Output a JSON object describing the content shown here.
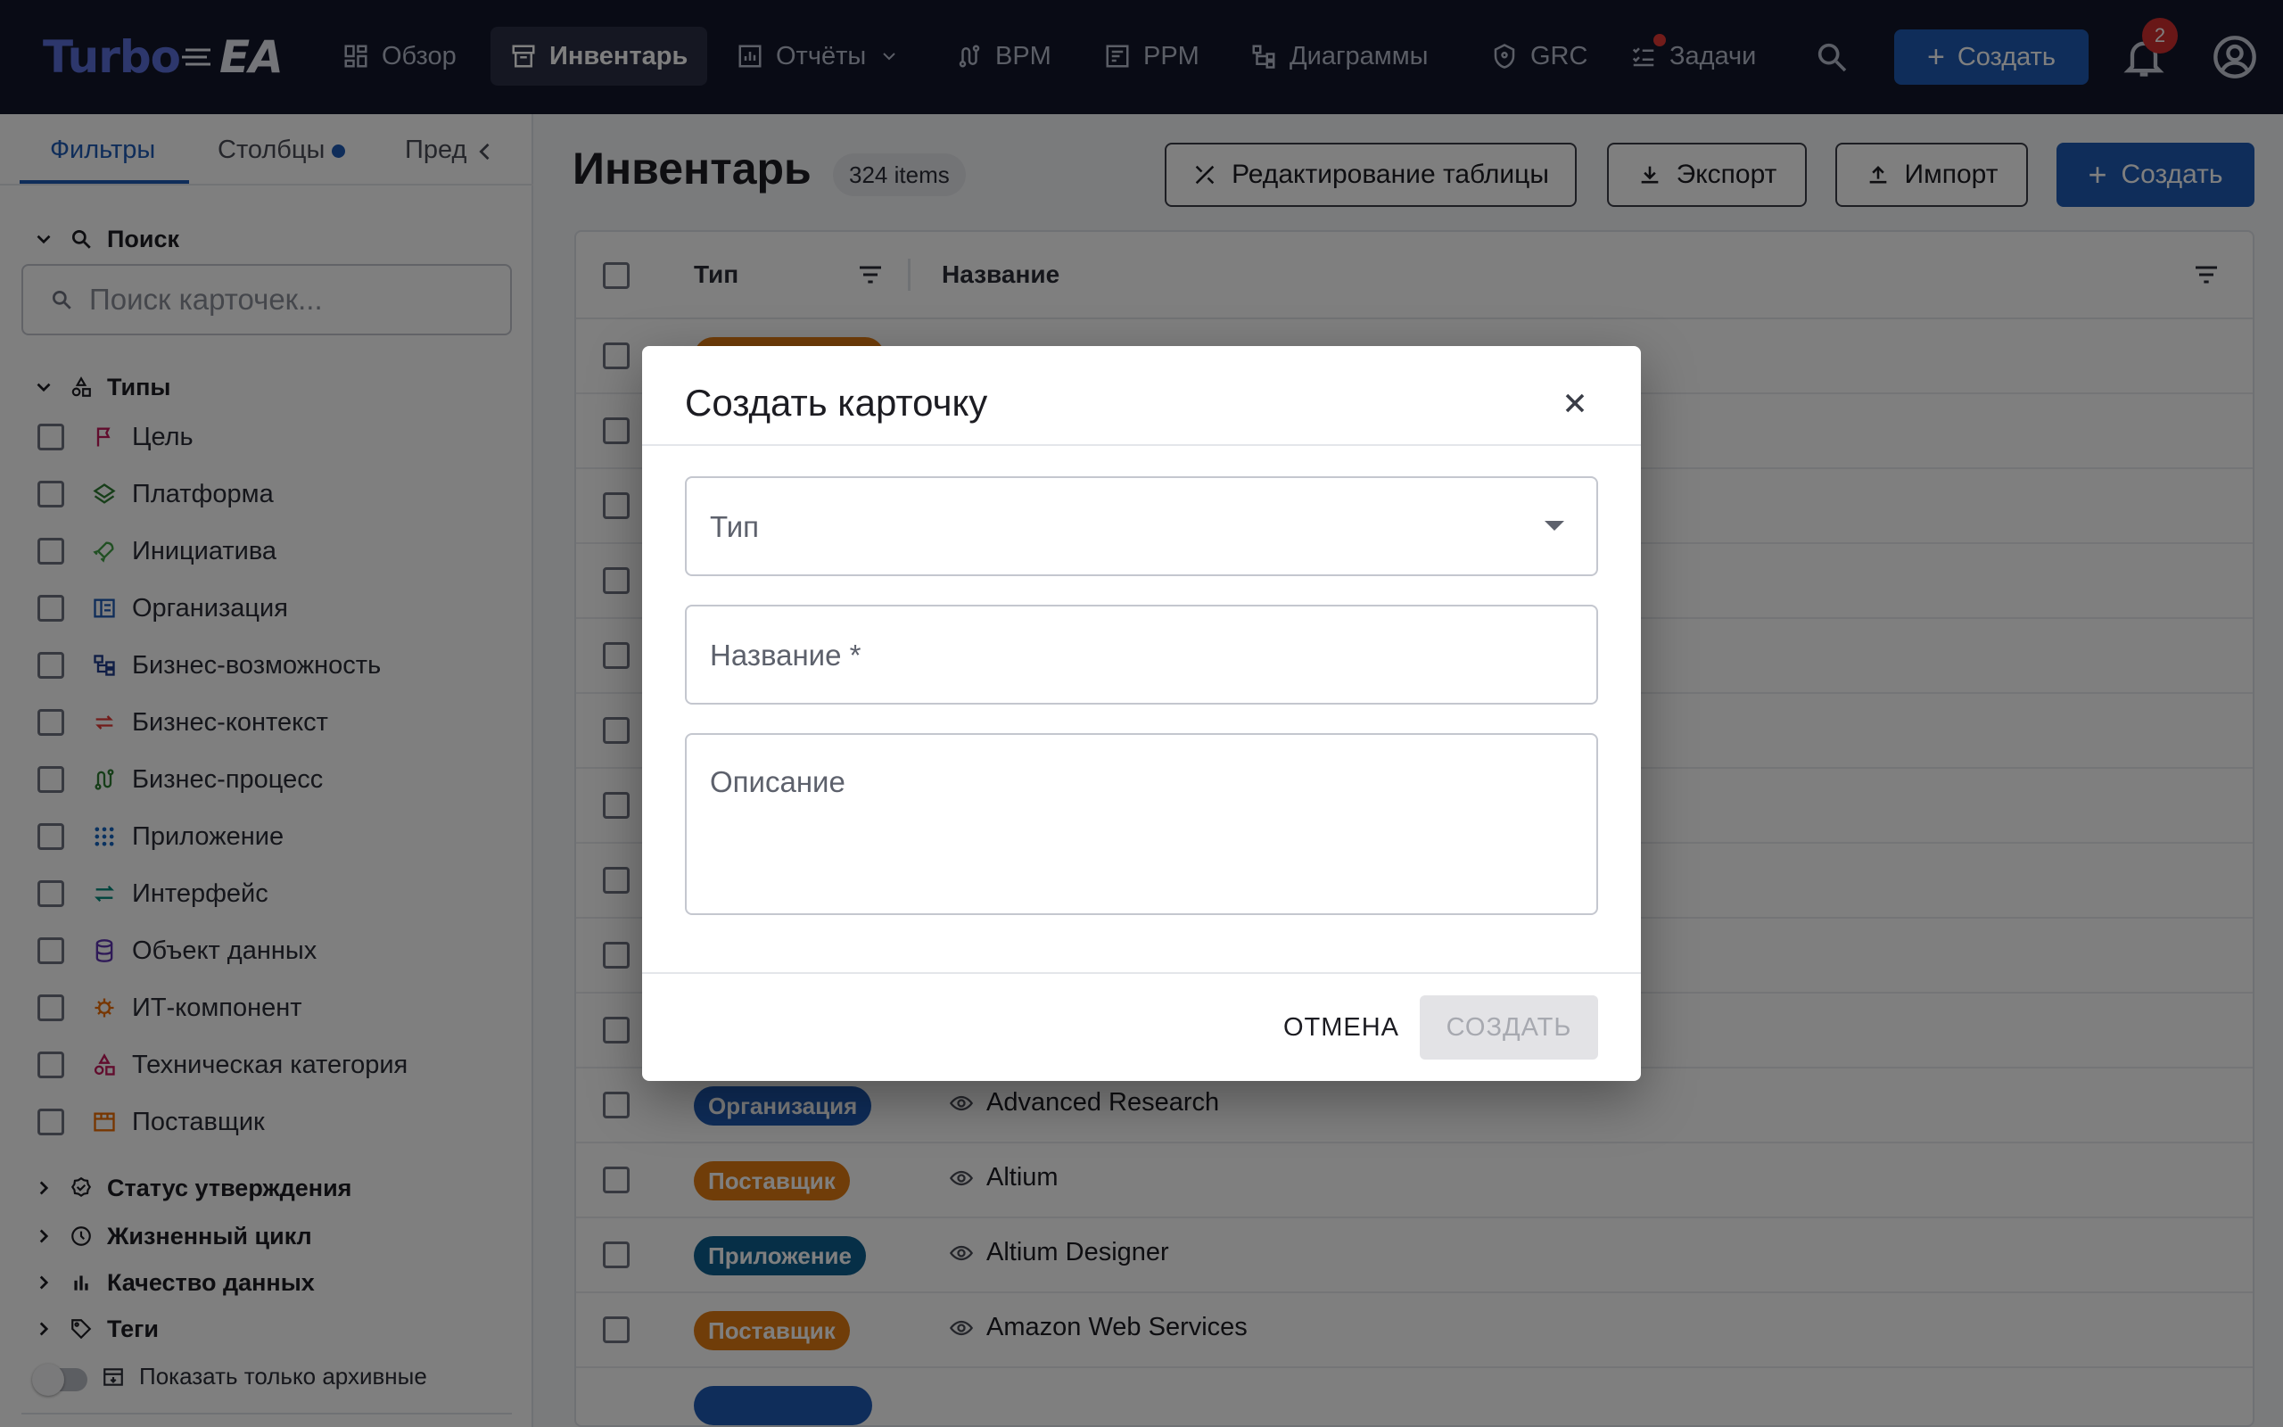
{
  "app": {
    "logo_part1": "Turbo",
    "logo_part2": "EA"
  },
  "nav": {
    "items": [
      {
        "label": "Обзор",
        "icon": "dashboard-icon"
      },
      {
        "label": "Инвентарь",
        "icon": "inventory-icon",
        "active": true
      },
      {
        "label": "Отчёты",
        "icon": "reports-icon",
        "has_dropdown": true
      },
      {
        "label": "BPM",
        "icon": "route-icon"
      },
      {
        "label": "PPM",
        "icon": "project-icon"
      },
      {
        "label": "Диаграммы",
        "icon": "diagram-icon"
      },
      {
        "label": "GRC",
        "icon": "shield-icon"
      },
      {
        "label": "Задачи",
        "icon": "tasks-icon",
        "dot": true
      }
    ],
    "create_label": "Создать",
    "notifications_count": "2"
  },
  "sidebar": {
    "tabs": [
      {
        "label": "Фильтры",
        "active": true
      },
      {
        "label": "Столбцы",
        "dot": true
      },
      {
        "label": "Пред"
      }
    ],
    "search": {
      "heading": "Поиск",
      "placeholder": "Поиск карточек..."
    },
    "types": {
      "heading": "Типы",
      "items": [
        {
          "label": "Цель",
          "icon": "flag-icon",
          "color": "#c2185b"
        },
        {
          "label": "Платформа",
          "icon": "layers-icon",
          "color": "#2e7d32"
        },
        {
          "label": "Инициатива",
          "icon": "rocket-icon",
          "color": "#43a047"
        },
        {
          "label": "Организация",
          "icon": "building-icon",
          "color": "#1e5bb5"
        },
        {
          "label": "Бизнес-возможность",
          "icon": "hierarchy-icon",
          "color": "#1e3a8a"
        },
        {
          "label": "Бизнес-контекст",
          "icon": "swap-icon",
          "color": "#e53935"
        },
        {
          "label": "Бизнес-процесс",
          "icon": "route-icon",
          "color": "#2e7d32"
        },
        {
          "label": "Приложение",
          "icon": "apps-icon",
          "color": "#1565c0"
        },
        {
          "label": "Интерфейс",
          "icon": "arrows-icon",
          "color": "#00897b"
        },
        {
          "label": "Объект данных",
          "icon": "database-icon",
          "color": "#5e35b1"
        },
        {
          "label": "ИТ-компонент",
          "icon": "chip-icon",
          "color": "#ef6c00"
        },
        {
          "label": "Техническая категория",
          "icon": "category-icon",
          "color": "#c2185b"
        },
        {
          "label": "Поставщик",
          "icon": "store-icon",
          "color": "#ef6c00"
        }
      ]
    },
    "sections": [
      {
        "label": "Статус утверждения",
        "icon": "verified-icon"
      },
      {
        "label": "Жизненный цикл",
        "icon": "clock-icon"
      },
      {
        "label": "Качество данных",
        "icon": "bar-chart-icon"
      },
      {
        "label": "Теги",
        "icon": "tag-icon"
      }
    ],
    "archive_toggle_label": "Показать только архивные"
  },
  "main": {
    "title": "Инвентарь",
    "count": "324 items",
    "buttons": {
      "edit_table": "Редактирование таблицы",
      "export": "Экспорт",
      "import": "Импорт",
      "create": "Создать"
    },
    "table": {
      "columns": [
        "Тип",
        "Название"
      ],
      "rows": [
        {
          "type": "Организация",
          "name": "Advanced Research",
          "color": "#1e5bb5"
        },
        {
          "type": "Поставщик",
          "name": "Altium",
          "color": "#e07b12"
        },
        {
          "type": "Приложение",
          "name": "Altium Designer",
          "color": "#0d5e8f"
        },
        {
          "type": "Поставщик",
          "name": "Amazon Web Services",
          "color": "#e07b12"
        }
      ]
    }
  },
  "dialog": {
    "title": "Создать карточку",
    "type_label": "Тип",
    "name_label": "Название *",
    "description_label": "Описание",
    "cancel_label": "ОТМЕНА",
    "create_label": "СОЗДАТЬ"
  }
}
